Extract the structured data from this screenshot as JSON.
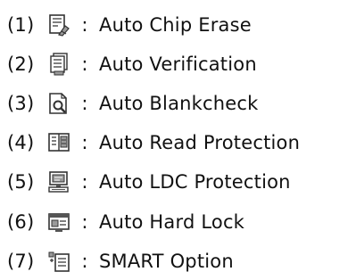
{
  "items": [
    {
      "number": "(1)",
      "icon": "auto-chip-erase-icon",
      "separator": ":",
      "label": "Auto Chip Erase"
    },
    {
      "number": "(2)",
      "icon": "auto-verification-icon",
      "separator": ":",
      "label": "Auto Verification"
    },
    {
      "number": "(3)",
      "icon": "auto-blankcheck-icon",
      "separator": ":",
      "label": "Auto Blankcheck"
    },
    {
      "number": "(4)",
      "icon": "auto-read-protection-icon",
      "separator": ":",
      "label": "Auto Read Protection"
    },
    {
      "number": "(5)",
      "icon": "auto-ldc-protection-icon",
      "separator": ":",
      "label": "Auto LDC Protection"
    },
    {
      "number": "(6)",
      "icon": "auto-hard-lock-icon",
      "separator": ":",
      "label": "Auto Hard Lock"
    },
    {
      "number": "(7)",
      "icon": "smart-option-icon",
      "separator": ":",
      "label": "SMART Option"
    }
  ],
  "colors": {
    "text": "#111111",
    "icon_stroke": "#333333",
    "icon_fill": "#ffffff",
    "icon_shade": "#9a9a9a",
    "icon_accent": "#555555"
  }
}
